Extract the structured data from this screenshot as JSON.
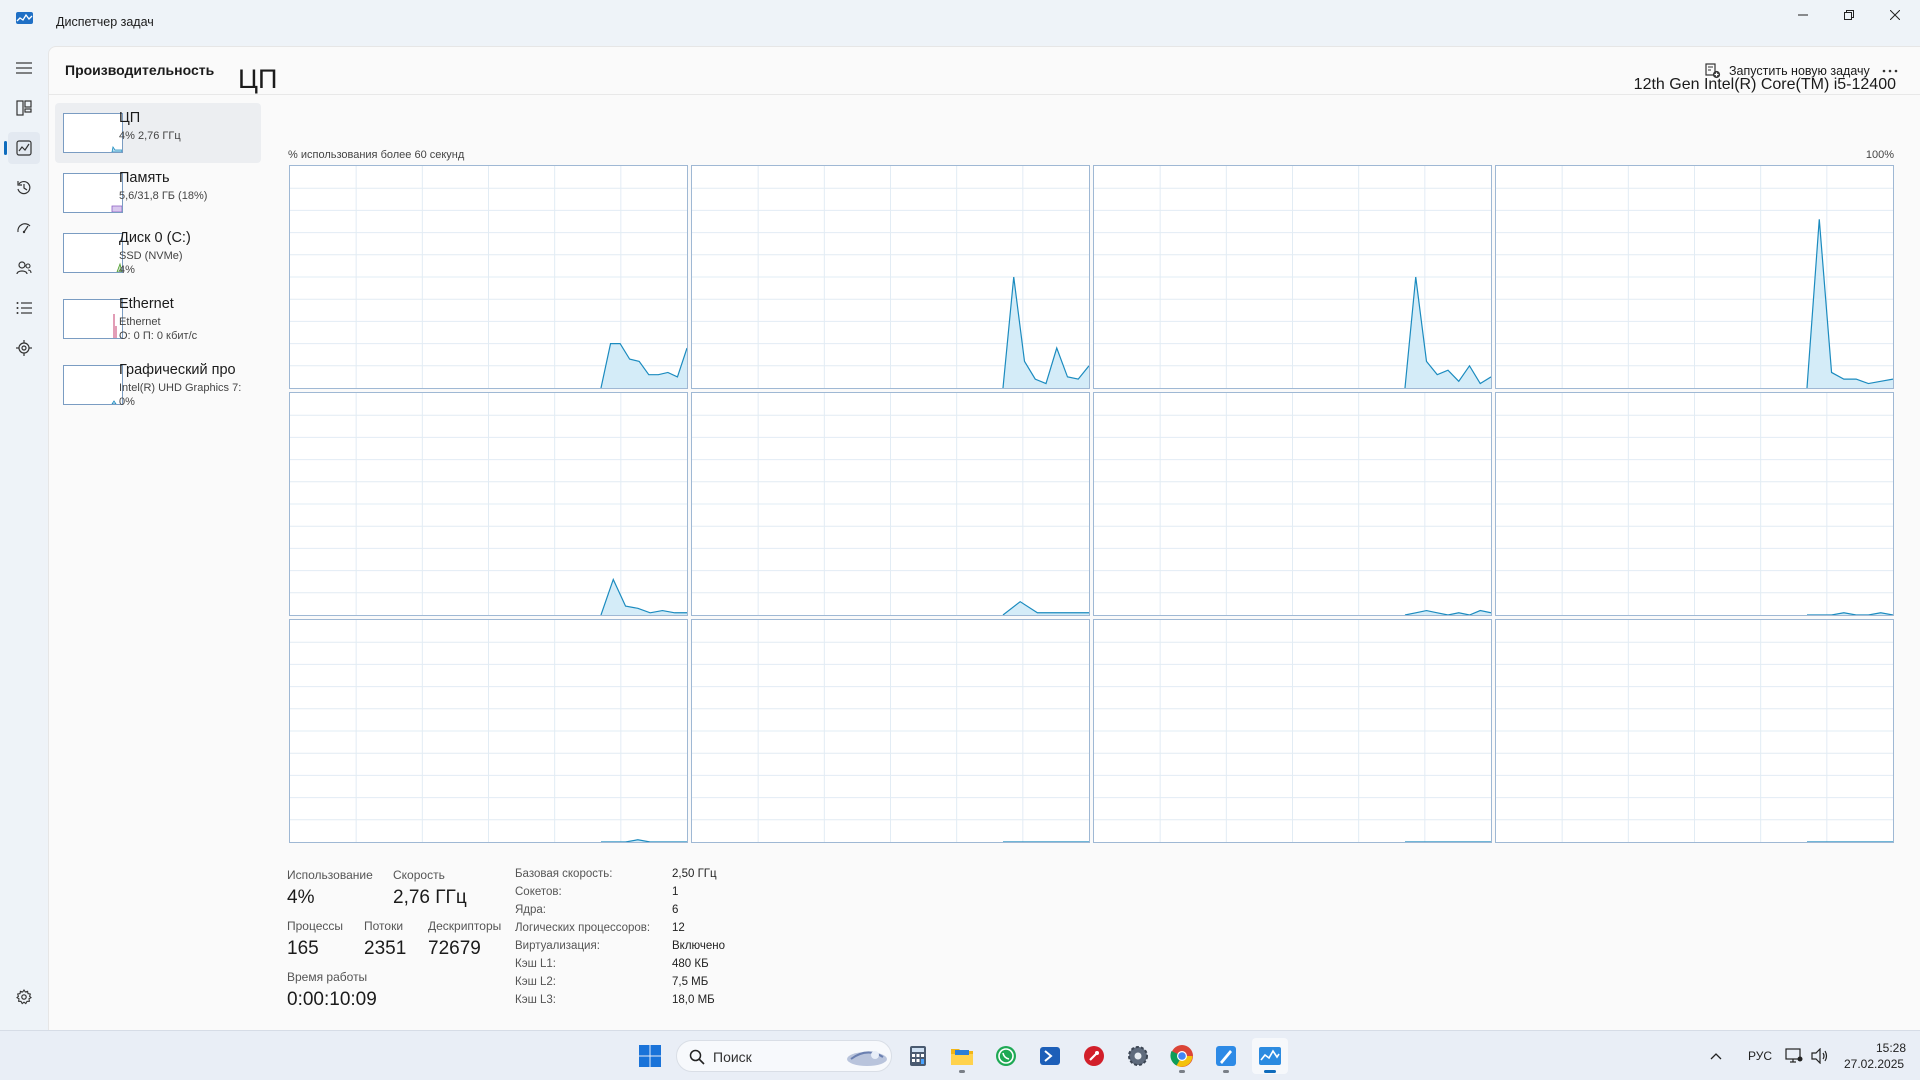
{
  "window": {
    "title": "Диспетчер задач",
    "icon": "task-manager-icon"
  },
  "header": {
    "page_title": "Производительность",
    "run_task_label": "Запустить новую задачу"
  },
  "nav": {
    "items": [
      {
        "name": "hamburger-menu-icon"
      },
      {
        "name": "processes-icon"
      },
      {
        "name": "performance-icon",
        "active": true
      },
      {
        "name": "app-history-icon"
      },
      {
        "name": "startup-apps-icon"
      },
      {
        "name": "users-icon"
      },
      {
        "name": "details-icon"
      },
      {
        "name": "services-icon"
      }
    ],
    "settings": "settings-gear-icon"
  },
  "devices": [
    {
      "name": "ЦП",
      "sub1": "4% 2,76 ГГц",
      "sub2": "",
      "selected": true
    },
    {
      "name": "Память",
      "sub1": "5,6/31,8 ГБ (18%)",
      "sub2": ""
    },
    {
      "name": "Диск 0 (C:)",
      "sub1": "SSD (NVMe)",
      "sub2": "4%"
    },
    {
      "name": "Ethernet",
      "sub1": "Ethernet",
      "sub2": "О: 0 П: 0 кбит/с"
    },
    {
      "name": "Графический про",
      "sub1": "Intel(R) UHD Graphics 7:",
      "sub2": "0%"
    }
  ],
  "cpu": {
    "title": "ЦП",
    "model": "12th Gen Intel(R) Core(TM) i5-12400",
    "graph_label": "% использования более 60 секунд",
    "graph_max": "100%",
    "accent_color": "#1b8bbf",
    "fill_color": "#d4ecf8",
    "grid_color": "#e2ecf4"
  },
  "chart_data": {
    "type": "area",
    "title": "% использования более 60 секунд",
    "ylim": [
      0,
      100
    ],
    "xlim": [
      0,
      60
    ],
    "x_start": 47,
    "series": [
      {
        "values": [
          0,
          20,
          20,
          13,
          12,
          6,
          6,
          7,
          5,
          18
        ]
      },
      {
        "values": [
          0,
          50,
          12,
          4,
          2,
          18,
          5,
          4,
          10
        ]
      },
      {
        "values": [
          0,
          50,
          12,
          6,
          8,
          3,
          10,
          2,
          5
        ]
      },
      {
        "values": [
          0,
          76,
          7,
          4,
          4,
          2,
          3,
          4
        ]
      },
      {
        "values": [
          0,
          16,
          4,
          3,
          1,
          2,
          1,
          1
        ]
      },
      {
        "values": [
          0,
          6,
          1,
          1,
          1,
          1
        ]
      },
      {
        "values": [
          0,
          1,
          2,
          1,
          0,
          1,
          0,
          2,
          1
        ]
      },
      {
        "values": [
          0,
          0,
          0,
          1,
          0,
          0,
          1,
          0
        ]
      },
      {
        "values": [
          0,
          0,
          0,
          1,
          0,
          0,
          0,
          0
        ]
      },
      {
        "values": [
          0,
          0,
          0,
          0
        ]
      },
      {
        "values": [
          0,
          0,
          0,
          0
        ]
      },
      {
        "values": [
          0,
          0,
          0,
          0
        ]
      }
    ]
  },
  "stats": {
    "usage_label": "Использование",
    "usage_value": "4%",
    "speed_label": "Скорость",
    "speed_value": "2,76 ГГц",
    "processes_label": "Процессы",
    "processes_value": "165",
    "threads_label": "Потоки",
    "threads_value": "2351",
    "handles_label": "Дескрипторы",
    "handles_value": "72679",
    "uptime_label": "Время работы",
    "uptime_value": "0:00:10:09"
  },
  "specs": [
    {
      "label": "Базовая скорость:",
      "value": "2,50 ГГц"
    },
    {
      "label": "Сокетов:",
      "value": "1"
    },
    {
      "label": "Ядра:",
      "value": "6"
    },
    {
      "label": "Логических процессоров:",
      "value": "12"
    },
    {
      "label": "Виртуализация:",
      "value": "Включено"
    },
    {
      "label": "Кэш L1:",
      "value": "480 КБ"
    },
    {
      "label": "Кэш L2:",
      "value": "7,5 МБ"
    },
    {
      "label": "Кэш L3:",
      "value": "18,0 МБ"
    }
  ],
  "taskbar": {
    "search_placeholder": "Поиск",
    "language": "РУС",
    "time": "15:28",
    "date": "27.02.2025"
  }
}
